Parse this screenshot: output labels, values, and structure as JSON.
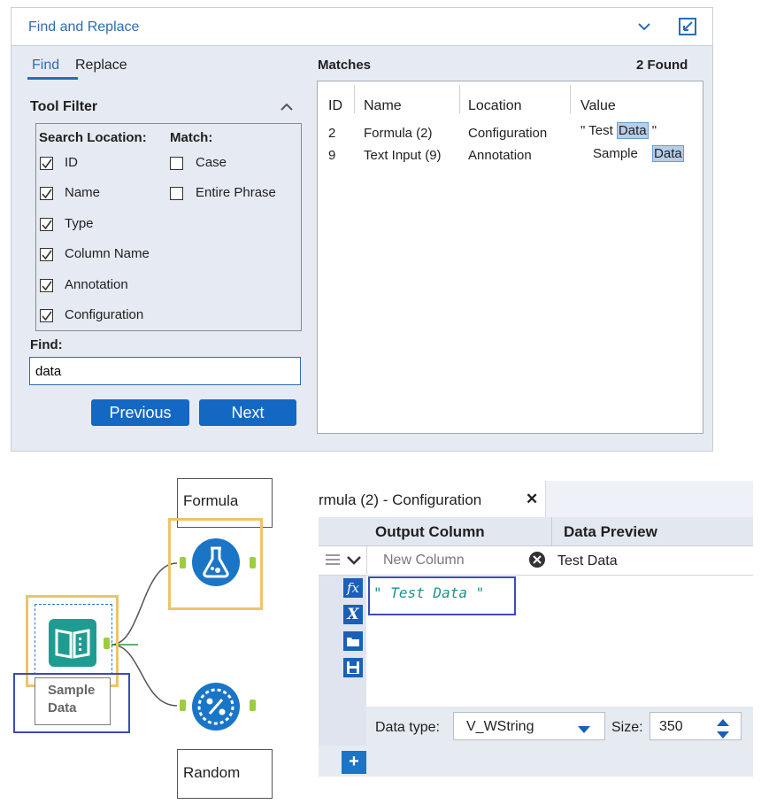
{
  "find_replace": {
    "title": "Find and Replace",
    "tabs": {
      "find": "Find",
      "replace": "Replace"
    },
    "tool_filter": {
      "title": "Tool Filter",
      "search_location_label": "Search Location:",
      "match_label": "Match:",
      "search_locations": [
        {
          "label": "ID",
          "checked": true
        },
        {
          "label": "Name",
          "checked": true
        },
        {
          "label": "Type",
          "checked": true
        },
        {
          "label": "Column Name",
          "checked": true
        },
        {
          "label": "Annotation",
          "checked": true
        },
        {
          "label": "Configuration",
          "checked": true
        }
      ],
      "match_options": [
        {
          "label": "Case",
          "checked": false
        },
        {
          "label": "Entire Phrase",
          "checked": false
        }
      ]
    },
    "find_label": "Find:",
    "find_value": "data",
    "previous_label": "Previous",
    "next_label": "Next",
    "matches": {
      "title": "Matches",
      "count": "2 Found",
      "columns": [
        "ID",
        "Name",
        "Location",
        "Value"
      ],
      "rows": [
        {
          "id": "2",
          "name": "Formula (2)",
          "location": "Configuration",
          "value_pre": "\" Test ",
          "value_hl": "Data",
          "value_post": " \""
        },
        {
          "id": "9",
          "name": "Text Input (9)",
          "location": "Annotation",
          "value_pre": "Sample ",
          "value_hl": "Data",
          "value_post": ""
        }
      ]
    }
  },
  "workflow": {
    "formula_label": "Formula",
    "random_label": "Random",
    "sample_label_line1": "Sample",
    "sample_label_line2": "Data"
  },
  "config": {
    "tab_title": "rmula (2) - Configuration",
    "close": "✕",
    "output_column_header": "Output Column",
    "data_preview_header": "Data Preview",
    "output_placeholder": "New Column",
    "preview_value": "Test Data",
    "expression": "\" Test Data \"",
    "data_type_label": "Data type:",
    "data_type_value": "V_WString",
    "size_label": "Size:",
    "size_value": "350",
    "add": "+"
  },
  "colors": {
    "accent": "#2b6cb3",
    "button": "#1368c4",
    "highlight_box": "#3b4cb8",
    "selection": "#f0c26b",
    "connector": "#9ccd3d",
    "tool_blue": "#1a75c7",
    "tool_teal": "#1f9c92"
  }
}
